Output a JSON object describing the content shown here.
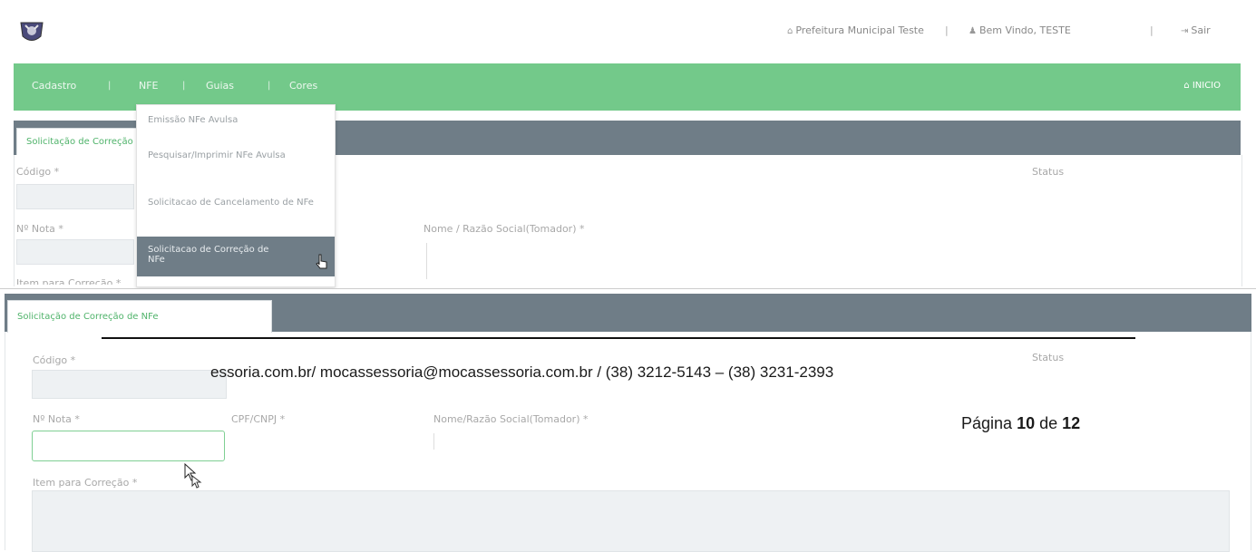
{
  "header": {
    "prefeitura": "Prefeitura Municipal Teste",
    "welcome": "Bem Vindo, TESTE",
    "exit": "Sair",
    "separator": "|"
  },
  "nav": {
    "items": [
      "Cadastro",
      "NFE",
      "Guias",
      "Cores"
    ],
    "inicio": "INICIO"
  },
  "dropdown": {
    "items": [
      "Emissão NFe Avulsa",
      "Pesquisar/Imprimir NFe Avulsa",
      "Solicitacao de Cancelamento de NFe",
      "Solicitacao de Correção de NFe"
    ]
  },
  "back_panel": {
    "tab": "Solicitação de Correção de NFe",
    "codigo_label": "Código *",
    "status_label": "Status",
    "nota_label": "Nº Nota *",
    "nome_label": "Nome / Razão Social(Tomador) *",
    "item_label": "Item para Correção *"
  },
  "front_panel": {
    "tab": "Solicitação de Correção de NFe",
    "codigo_label": "Código *",
    "status_label": "Status",
    "nota_label": "Nº Nota *",
    "cpf_label": "CPF/CNPJ *",
    "nome_label": "Nome/Razão Social(Tomador) *",
    "item_label": "Item para Correção *"
  },
  "doc_footer": {
    "contact": "essoria.com.br/ mocassessoria@mocassessoria.com.br / (38) 3212-5143 – (38) 3231-2393",
    "page_prefix": "Página ",
    "page_current": "10",
    "page_middle": " de ",
    "page_total": "12"
  },
  "colors": {
    "nav_green": "#73c98a",
    "panel_gray": "#6f7d87",
    "tab_green": "#4fb36a"
  }
}
